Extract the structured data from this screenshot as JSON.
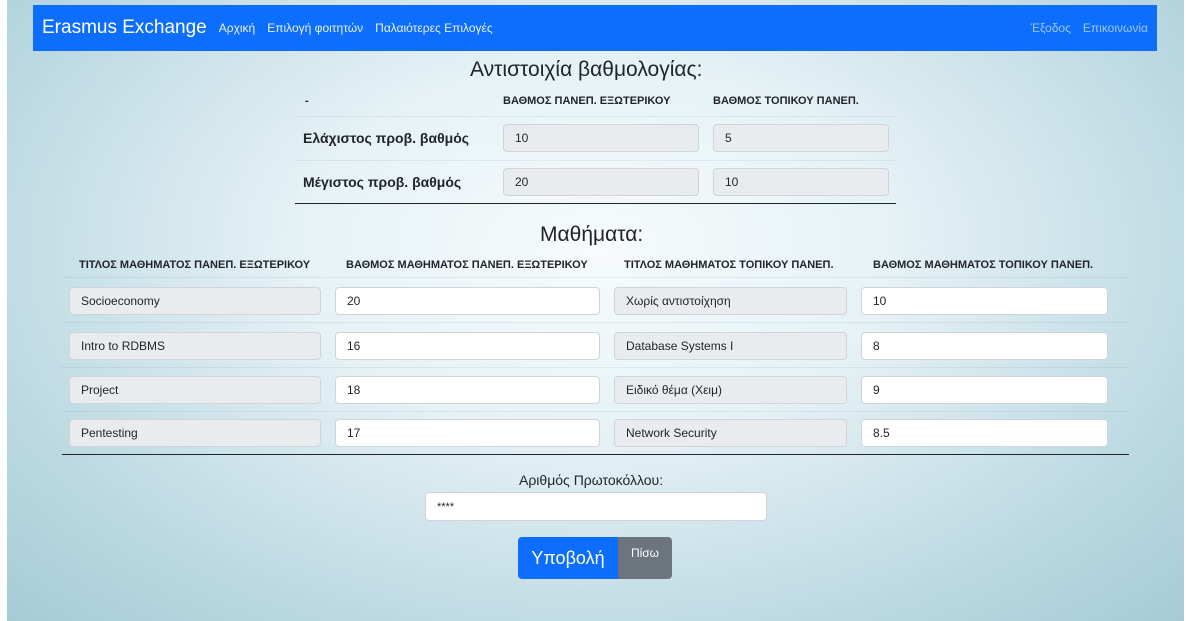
{
  "navbar": {
    "brand": "Erasmus Exchange",
    "links": [
      "Αρχική",
      "Επιλογή φοιτητών",
      "Παλαιότερες Επιλογές"
    ],
    "right_links": [
      "Έξοδος",
      "Επικοινωνία"
    ]
  },
  "grading": {
    "title": "Αντιστοιχία βαθμολογίας:",
    "headers": [
      "-",
      "ΒΑΘΜΟΣ ΠΑΝΕΠ. ΕΞΩΤΕΡΙΚΟΥ",
      "ΒΑΘΜΟΣ ΤΟΠΙΚΟΥ ΠΑΝΕΠ."
    ],
    "rows": [
      {
        "label": "Ελάχιστος προβ. βαθμός",
        "foreign": "10",
        "local": "5"
      },
      {
        "label": "Μέγιστος προβ. βαθμός",
        "foreign": "20",
        "local": "10"
      }
    ]
  },
  "courses": {
    "title": "Μαθήματα:",
    "headers": [
      "ΤΙΤΛΟΣ ΜΑΘΗΜΑΤΟΣ ΠΑΝΕΠ. ΕΞΩΤΕΡΙΚΟΥ",
      "ΒΑΘΜΟΣ ΜΑΘΗΜΑΤΟΣ ΠΑΝΕΠ. ΕΞΩΤΕΡΙΚΟΥ",
      "ΤΙΤΛΟΣ ΜΑΘΗΜΑΤΟΣ ΤΟΠΙΚΟΥ ΠΑΝΕΠ.",
      "ΒΑΘΜΟΣ ΜΑΘΗΜΑΤΟΣ ΤΟΠΙΚΟΥ ΠΑΝΕΠ."
    ],
    "rows": [
      {
        "foreign_title": "Socioeconomy",
        "foreign_grade": "20",
        "local_title": "Χωρίς αντιστοίχηση",
        "local_grade": "10"
      },
      {
        "foreign_title": "Intro to RDBMS",
        "foreign_grade": "16",
        "local_title": "Database Systems I",
        "local_grade": "8"
      },
      {
        "foreign_title": "Project",
        "foreign_grade": "18",
        "local_title": "Ειδικό θέμα (Χειμ)",
        "local_grade": "9"
      },
      {
        "foreign_title": "Pentesting",
        "foreign_grade": "17",
        "local_title": "Network Security",
        "local_grade": "8.5"
      }
    ]
  },
  "protocol": {
    "label": "Αριθμός Πρωτοκόλλου:",
    "value": "****"
  },
  "buttons": {
    "submit": "Υποβολή",
    "back": "Πίσω"
  },
  "colors": {
    "primary": "#0d6efd",
    "secondary": "#6c757d"
  }
}
